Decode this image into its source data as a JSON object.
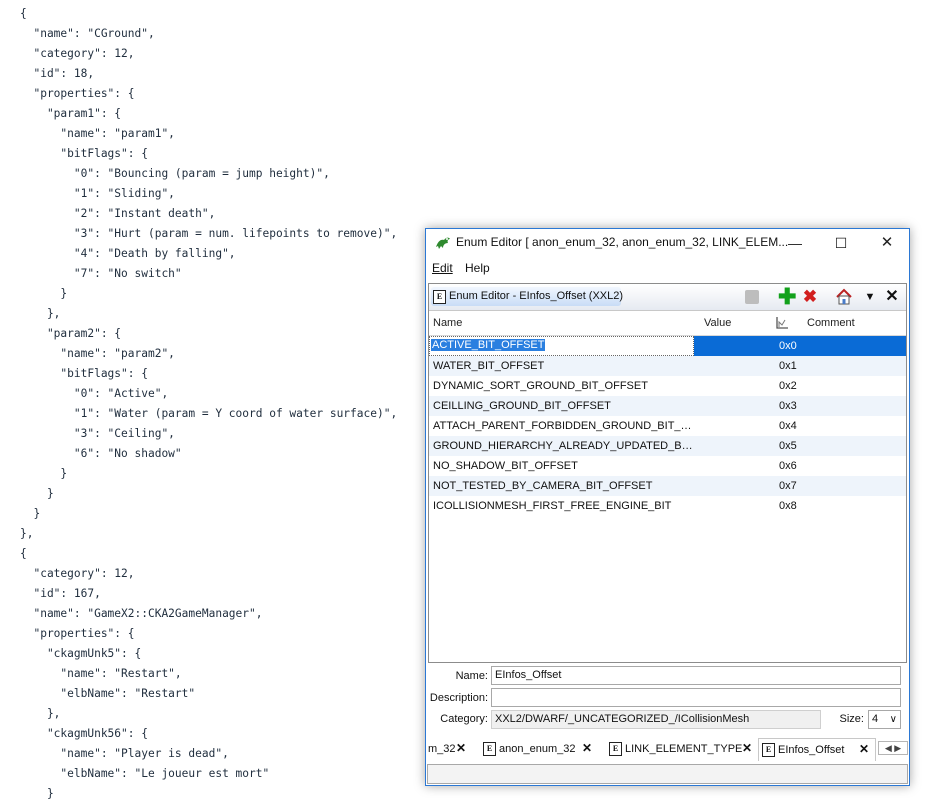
{
  "code_lines": [
    "{",
    "  \"name\": \"CGround\",",
    "  \"category\": 12,",
    "  \"id\": 18,",
    "  \"properties\": {",
    "    \"param1\": {",
    "      \"name\": \"param1\",",
    "      \"bitFlags\": {",
    "        \"0\": \"Bouncing (param = jump height)\",",
    "        \"1\": \"Sliding\",",
    "        \"2\": \"Instant death\",",
    "        \"3\": \"Hurt (param = num. lifepoints to remove)\",",
    "        \"4\": \"Death by falling\",",
    "        \"7\": \"No switch\"",
    "      }",
    "    },",
    "    \"param2\": {",
    "      \"name\": \"param2\",",
    "      \"bitFlags\": {",
    "        \"0\": \"Active\",",
    "        \"1\": \"Water (param = Y coord of water surface)\",",
    "        \"3\": \"Ceiling\",",
    "        \"6\": \"No shadow\"",
    "      }",
    "    }",
    "  }",
    "},",
    "{",
    "  \"category\": 12,",
    "  \"id\": 167,",
    "  \"name\": \"GameX2::CKA2GameManager\",",
    "  \"properties\": {",
    "    \"ckagmUnk5\": {",
    "      \"name\": \"Restart\",",
    "      \"elbName\": \"Restart\"",
    "    },",
    "    \"ckagmUnk56\": {",
    "      \"name\": \"Player is dead\",",
    "      \"elbName\": \"Le joueur est mort\"",
    "    }"
  ],
  "window": {
    "title": "Enum Editor [ anon_enum_32, anon_enum_32, LINK_ELEM...",
    "minimize": "—",
    "maximize": "☐",
    "close": "✕"
  },
  "menu": {
    "edit": "Edit",
    "help": "Help"
  },
  "panel": {
    "title": "Enum Editor - EInfos_Offset (XXL2)",
    "doc_icon_letter": "E",
    "add_icon": "✚",
    "remove_icon": "✖",
    "dropdown_icon": "▼",
    "close_icon": "✕"
  },
  "table": {
    "headers": {
      "name": "Name",
      "value": "Value",
      "comment": "Comment"
    },
    "rows": [
      {
        "name": "ACTIVE_BIT_OFFSET",
        "value": "0x0"
      },
      {
        "name": "WATER_BIT_OFFSET",
        "value": "0x1"
      },
      {
        "name": "DYNAMIC_SORT_GROUND_BIT_OFFSET",
        "value": "0x2"
      },
      {
        "name": "CEILLING_GROUND_BIT_OFFSET",
        "value": "0x3"
      },
      {
        "name": "ATTACH_PARENT_FORBIDDEN_GROUND_BIT_OFF...",
        "value": "0x4"
      },
      {
        "name": "GROUND_HIERARCHY_ALREADY_UPDATED_BIT_O...",
        "value": "0x5"
      },
      {
        "name": "NO_SHADOW_BIT_OFFSET",
        "value": "0x6"
      },
      {
        "name": "NOT_TESTED_BY_CAMERA_BIT_OFFSET",
        "value": "0x7"
      },
      {
        "name": "ICOLLISIONMESH_FIRST_FREE_ENGINE_BIT",
        "value": "0x8"
      }
    ],
    "selected_index": 0
  },
  "form": {
    "name_label": "Name:",
    "name_value": "EInfos_Offset",
    "description_label": "Description:",
    "description_value": "",
    "category_label": "Category:",
    "category_value": "XXL2/DWARF/_UNCATEGORIZED_/ICollisionMesh",
    "size_label": "Size:",
    "size_value": "4",
    "size_chevron": "∨"
  },
  "tabs": [
    {
      "label": "m_32",
      "active": false
    },
    {
      "label": "anon_enum_32",
      "active": false
    },
    {
      "label": "LINK_ELEMENT_TYPE",
      "active": false
    },
    {
      "label": "EInfos_Offset",
      "active": true
    }
  ],
  "tab_close_icon": "✕",
  "tab_scroll": "◀ ▶",
  "colors": {
    "selection": "#0a6bd6",
    "window_border": "#2b78d4",
    "add": "#12a11b",
    "remove": "#d21f1f"
  }
}
